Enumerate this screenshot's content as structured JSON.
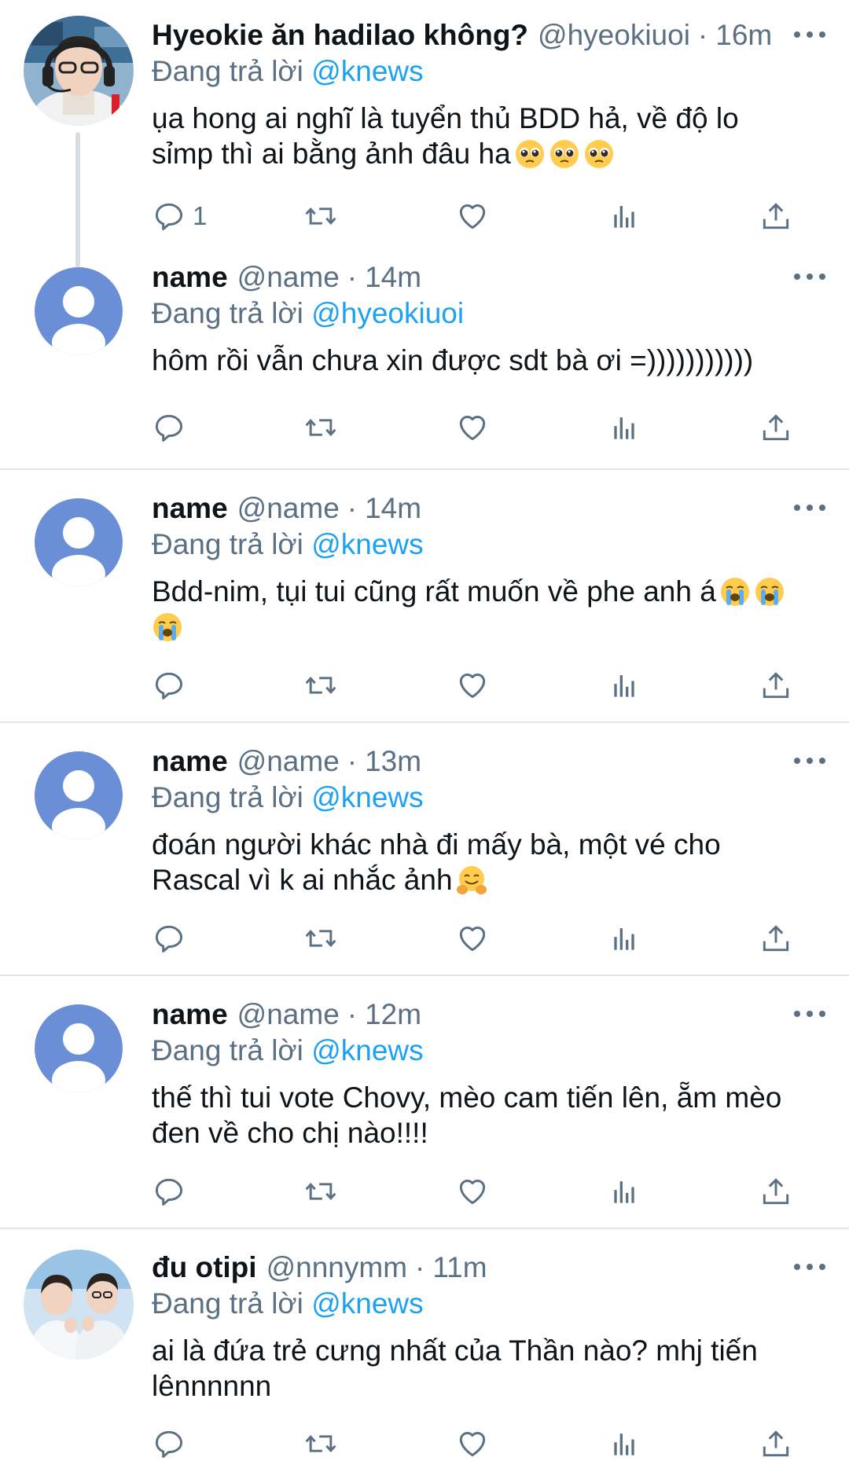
{
  "tweets": [
    {
      "name": "Hyeokie ăn hadilao không?",
      "handle": "@hyeokiuoi",
      "dot": "·",
      "time": "16m",
      "reply_prefix": "Đang trả lời",
      "reply_to": "@knews",
      "text_lines": [
        "ụa hong ai nghĩ là tuyển thủ BDD hả, về độ lo",
        "sỉmp thì ai bằng ảnh đâu ha"
      ],
      "emojis": [
        "pleading-face",
        "pleading-face",
        "pleading-face"
      ],
      "reply_count": "1",
      "avatar": "player-photo"
    },
    {
      "name": "name",
      "handle": "@name",
      "dot": "·",
      "time": "14m",
      "reply_prefix": "Đang trả lời",
      "reply_to": "@hyeokiuoi",
      "text_lines": [
        "hôm rồi vẫn chưa xin được sdt bà ơi =)))))))))))"
      ],
      "avatar": "default-avatar"
    },
    {
      "name": "name",
      "handle": "@name",
      "dot": "·",
      "time": "14m",
      "reply_prefix": "Đang trả lời",
      "reply_to": "@knews",
      "text_lines": [
        "Bdd-nim, tụi tui cũng rất muốn về phe anh á"
      ],
      "emojis": [
        "loudly-crying-face",
        "loudly-crying-face",
        "loudly-crying-face"
      ],
      "avatar": "default-avatar"
    },
    {
      "name": "name",
      "handle": "@name",
      "dot": "·",
      "time": "13m",
      "reply_prefix": "Đang trả lời",
      "reply_to": "@knews",
      "text_lines": [
        "đoán người khác nhà đi mấy bà, một vé cho",
        "Rascal vì k ai nhắc ảnh"
      ],
      "emojis": [
        "hugging-face"
      ],
      "avatar": "default-avatar"
    },
    {
      "name": "name",
      "handle": "@name",
      "dot": "·",
      "time": "12m",
      "reply_prefix": "Đang trả lời",
      "reply_to": "@knews",
      "text_lines": [
        "thế thì tui vote Chovy, mèo cam tiến lên, ẵm mèo",
        "đen về cho chị nào!!!!"
      ],
      "avatar": "default-avatar"
    },
    {
      "name": "đu otipi",
      "handle": "@nnnymm",
      "dot": "·",
      "time": "11m",
      "reply_prefix": "Đang trả lời",
      "reply_to": "@knews",
      "text_lines": [
        "ai là đứa trẻ cưng nhất của Thần nào? mhj tiến",
        "lênnnnnn"
      ],
      "avatar": "duo-photo"
    }
  ],
  "icons": {
    "reply": "comment-icon",
    "retweet": "retweet-icon",
    "like": "heart-icon",
    "stats": "bar-chart-icon",
    "share": "share-icon",
    "more": "more-dots-icon"
  },
  "colors": {
    "link": "#1da1f2",
    "secondary": "#5b7083",
    "divider": "#e3e7ea",
    "default_avatar": "#6b8fd6"
  }
}
